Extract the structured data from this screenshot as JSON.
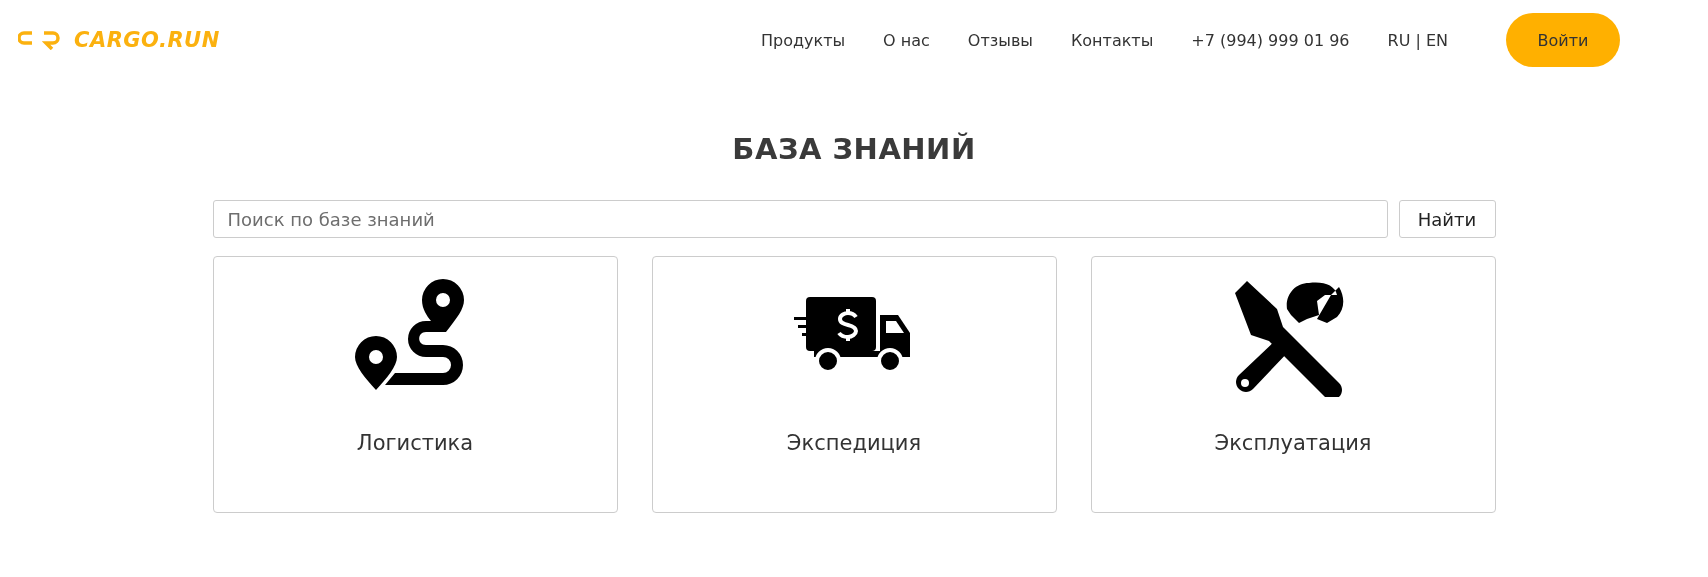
{
  "header": {
    "logo": "CARGO.RUN",
    "nav": [
      "Продукты",
      "О нас",
      "Отзывы",
      "Контакты",
      "+7 (994) 999 01 96",
      "RU | EN"
    ],
    "login_button": "Войти"
  },
  "title": "БАЗА ЗНАНИЙ",
  "search": {
    "placeholder": "Поиск по базе знаний",
    "button": "Найти"
  },
  "cards": [
    {
      "kind": "route",
      "label": "Логистика"
    },
    {
      "kind": "truck",
      "label": "Экспедиция"
    },
    {
      "kind": "tools",
      "label": "Эксплуатация"
    }
  ]
}
